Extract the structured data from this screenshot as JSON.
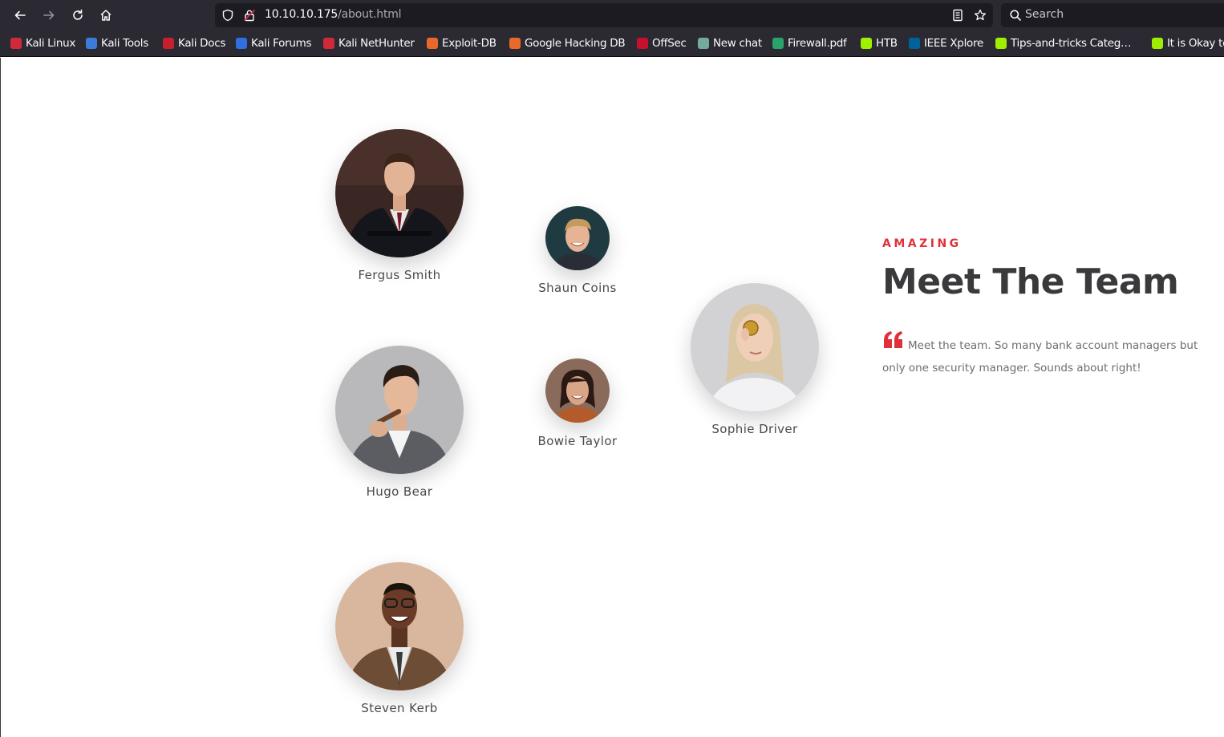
{
  "browser": {
    "url_host": "10.10.10.175",
    "url_path": "/about.html",
    "search_placeholder": "Search",
    "bookmarks": [
      {
        "label": "Kali Linux",
        "color": "#d02a3a"
      },
      {
        "label": "Kali Tools",
        "color": "#3d7bd9"
      },
      {
        "label": "Kali Docs",
        "color": "#c81f2d"
      },
      {
        "label": "Kali Forums",
        "color": "#2f6fe0"
      },
      {
        "label": "Kali NetHunter",
        "color": "#d02a3a"
      },
      {
        "label": "Exploit-DB",
        "color": "#e8692a"
      },
      {
        "label": "Google Hacking DB",
        "color": "#e8692a"
      },
      {
        "label": "OffSec",
        "color": "#c8102e"
      },
      {
        "label": "New chat",
        "color": "#74aa9c"
      },
      {
        "label": "Firewall.pdf",
        "color": "#2aa36b"
      },
      {
        "label": "HTB",
        "color": "#9fef00"
      },
      {
        "label": "IEEE Xplore",
        "color": "#00629b"
      },
      {
        "label": "Tips-and-tricks Categ…",
        "color": "#9fef00"
      },
      {
        "label": "It is Okay to",
        "color": "#9fef00"
      }
    ]
  },
  "team": {
    "kicker": "AMAZING",
    "title": "Meet The Team",
    "quote": "Meet the team. So many bank account managers but only one security manager. Sounds about right!",
    "accent_color": "#e0313b",
    "members": [
      {
        "name": "Fergus Smith"
      },
      {
        "name": "Shaun Coins"
      },
      {
        "name": "Sophie Driver"
      },
      {
        "name": "Hugo Bear"
      },
      {
        "name": "Bowie Taylor"
      },
      {
        "name": "Steven Kerb"
      }
    ]
  }
}
